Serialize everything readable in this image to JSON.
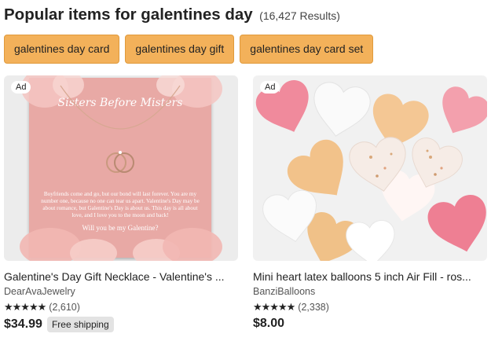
{
  "header": {
    "title": "Popular items for galentines day",
    "count": "(16,427 Results)"
  },
  "chips": [
    {
      "label": "galentines day card"
    },
    {
      "label": "galentines day gift"
    },
    {
      "label": "galentines day card set"
    }
  ],
  "products": [
    {
      "ad_label": "Ad",
      "title": "Galentine's Day Gift Necklace - Valentine's ...",
      "shop": "DearAvaJewelry",
      "stars": "★★★★★",
      "rating_count": "(2,610)",
      "rating_value": 5,
      "price": "$34.99",
      "shipping": "Free shipping",
      "image": {
        "heading": "Sisters Before Misters",
        "body": "Boyfriends come and go, but our bond will last forever. You are my number one, because no one can tear us apart. Valentine's Day may be about romance, but Galentine's Day is about us. This day is all about love, and I love you to the moon and back!",
        "ask": "Will you be my Galentine?"
      }
    },
    {
      "ad_label": "Ad",
      "title": "Mini heart latex balloons 5 inch Air Fill - ros...",
      "shop": "BanziBalloons",
      "stars": "★★★★★",
      "rating_count": "(2,338)",
      "rating_value": 5,
      "price": "$8.00",
      "shipping": ""
    }
  ],
  "colors": {
    "chip_bg": "#f3b15a",
    "card_pink": "#e8a9a5",
    "shipping_badge_bg": "#e3e3e3"
  }
}
